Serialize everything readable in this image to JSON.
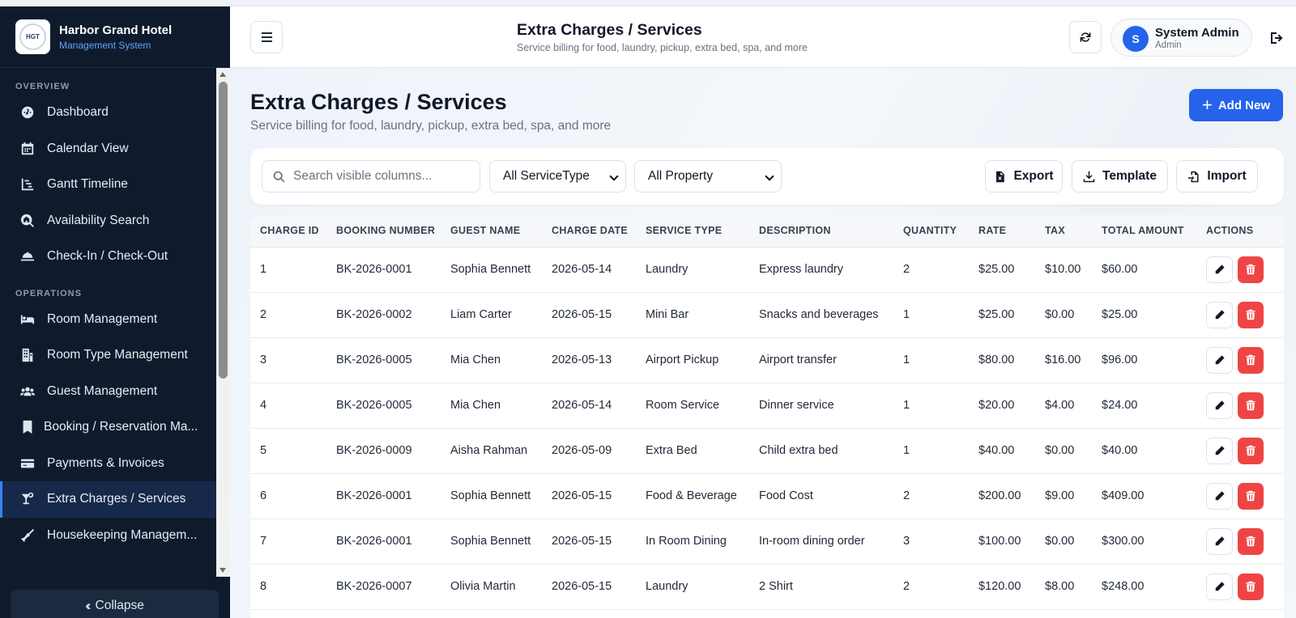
{
  "brand": {
    "name": "Harbor Grand Hotel",
    "subtitle": "Management System",
    "logo_text": "HGT"
  },
  "sidebar": {
    "sections": [
      {
        "title": "OVERVIEW",
        "items": [
          {
            "label": "Dashboard",
            "icon": "dashboard-icon"
          },
          {
            "label": "Calendar View",
            "icon": "calendar-icon"
          },
          {
            "label": "Gantt Timeline",
            "icon": "gantt-icon"
          },
          {
            "label": "Availability Search",
            "icon": "search-house-icon"
          },
          {
            "label": "Check-In / Check-Out",
            "icon": "bell-icon"
          }
        ]
      },
      {
        "title": "OPERATIONS",
        "items": [
          {
            "label": "Room Management",
            "icon": "bed-icon"
          },
          {
            "label": "Room Type Management",
            "icon": "building-icon"
          },
          {
            "label": "Guest Management",
            "icon": "users-icon"
          },
          {
            "label": "Booking / Reservation Ma...",
            "icon": "bookmark-icon"
          },
          {
            "label": "Payments & Invoices",
            "icon": "credit-card-icon"
          },
          {
            "label": "Extra Charges / Services",
            "icon": "cocktail-icon",
            "active": true
          },
          {
            "label": "Housekeeping Managem...",
            "icon": "broom-icon"
          }
        ]
      }
    ],
    "collapse_label": "Collapse"
  },
  "header": {
    "title": "Extra Charges / Services",
    "subtitle": "Service billing for food, laundry, pickup, extra bed, spa, and more",
    "user": {
      "initial": "S",
      "name": "System Admin",
      "role": "Admin"
    }
  },
  "page": {
    "title": "Extra Charges / Services",
    "subtitle": "Service billing for food, laundry, pickup, extra bed, spa, and more",
    "add_label": "Add New"
  },
  "toolbar": {
    "search_placeholder": "Search visible columns...",
    "service_filter": "All ServiceType",
    "property_filter": "All Property",
    "export_label": "Export",
    "template_label": "Template",
    "import_label": "Import"
  },
  "table": {
    "columns": [
      "CHARGE ID",
      "BOOKING NUMBER",
      "GUEST NAME",
      "CHARGE DATE",
      "SERVICE TYPE",
      "DESCRIPTION",
      "QUANTITY",
      "RATE",
      "TAX",
      "TOTAL AMOUNT",
      "ACTIONS"
    ],
    "rows": [
      [
        "1",
        "BK-2026-0001",
        "Sophia Bennett",
        "2026-05-14",
        "Laundry",
        "Express laundry",
        "2",
        "$25.00",
        "$10.00",
        "$60.00"
      ],
      [
        "2",
        "BK-2026-0002",
        "Liam Carter",
        "2026-05-15",
        "Mini Bar",
        "Snacks and beverages",
        "1",
        "$25.00",
        "$0.00",
        "$25.00"
      ],
      [
        "3",
        "BK-2026-0005",
        "Mia Chen",
        "2026-05-13",
        "Airport Pickup",
        "Airport transfer",
        "1",
        "$80.00",
        "$16.00",
        "$96.00"
      ],
      [
        "4",
        "BK-2026-0005",
        "Mia Chen",
        "2026-05-14",
        "Room Service",
        "Dinner service",
        "1",
        "$20.00",
        "$4.00",
        "$24.00"
      ],
      [
        "5",
        "BK-2026-0009",
        "Aisha Rahman",
        "2026-05-09",
        "Extra Bed",
        "Child extra bed",
        "1",
        "$40.00",
        "$0.00",
        "$40.00"
      ],
      [
        "6",
        "BK-2026-0001",
        "Sophia Bennett",
        "2026-05-15",
        "Food & Beverage",
        "Food Cost",
        "2",
        "$200.00",
        "$9.00",
        "$409.00"
      ],
      [
        "7",
        "BK-2026-0001",
        "Sophia Bennett",
        "2026-05-15",
        "In Room Dining",
        "In-room dining order",
        "3",
        "$100.00",
        "$0.00",
        "$300.00"
      ],
      [
        "8",
        "BK-2026-0007",
        "Olivia Martin",
        "2026-05-15",
        "Laundry",
        "2 Shirt",
        "2",
        "$120.00",
        "$8.00",
        "$248.00"
      ]
    ]
  },
  "colors": {
    "sidebar_bg": "#0f1b2d",
    "accent": "#2563eb",
    "danger": "#ef4444"
  }
}
